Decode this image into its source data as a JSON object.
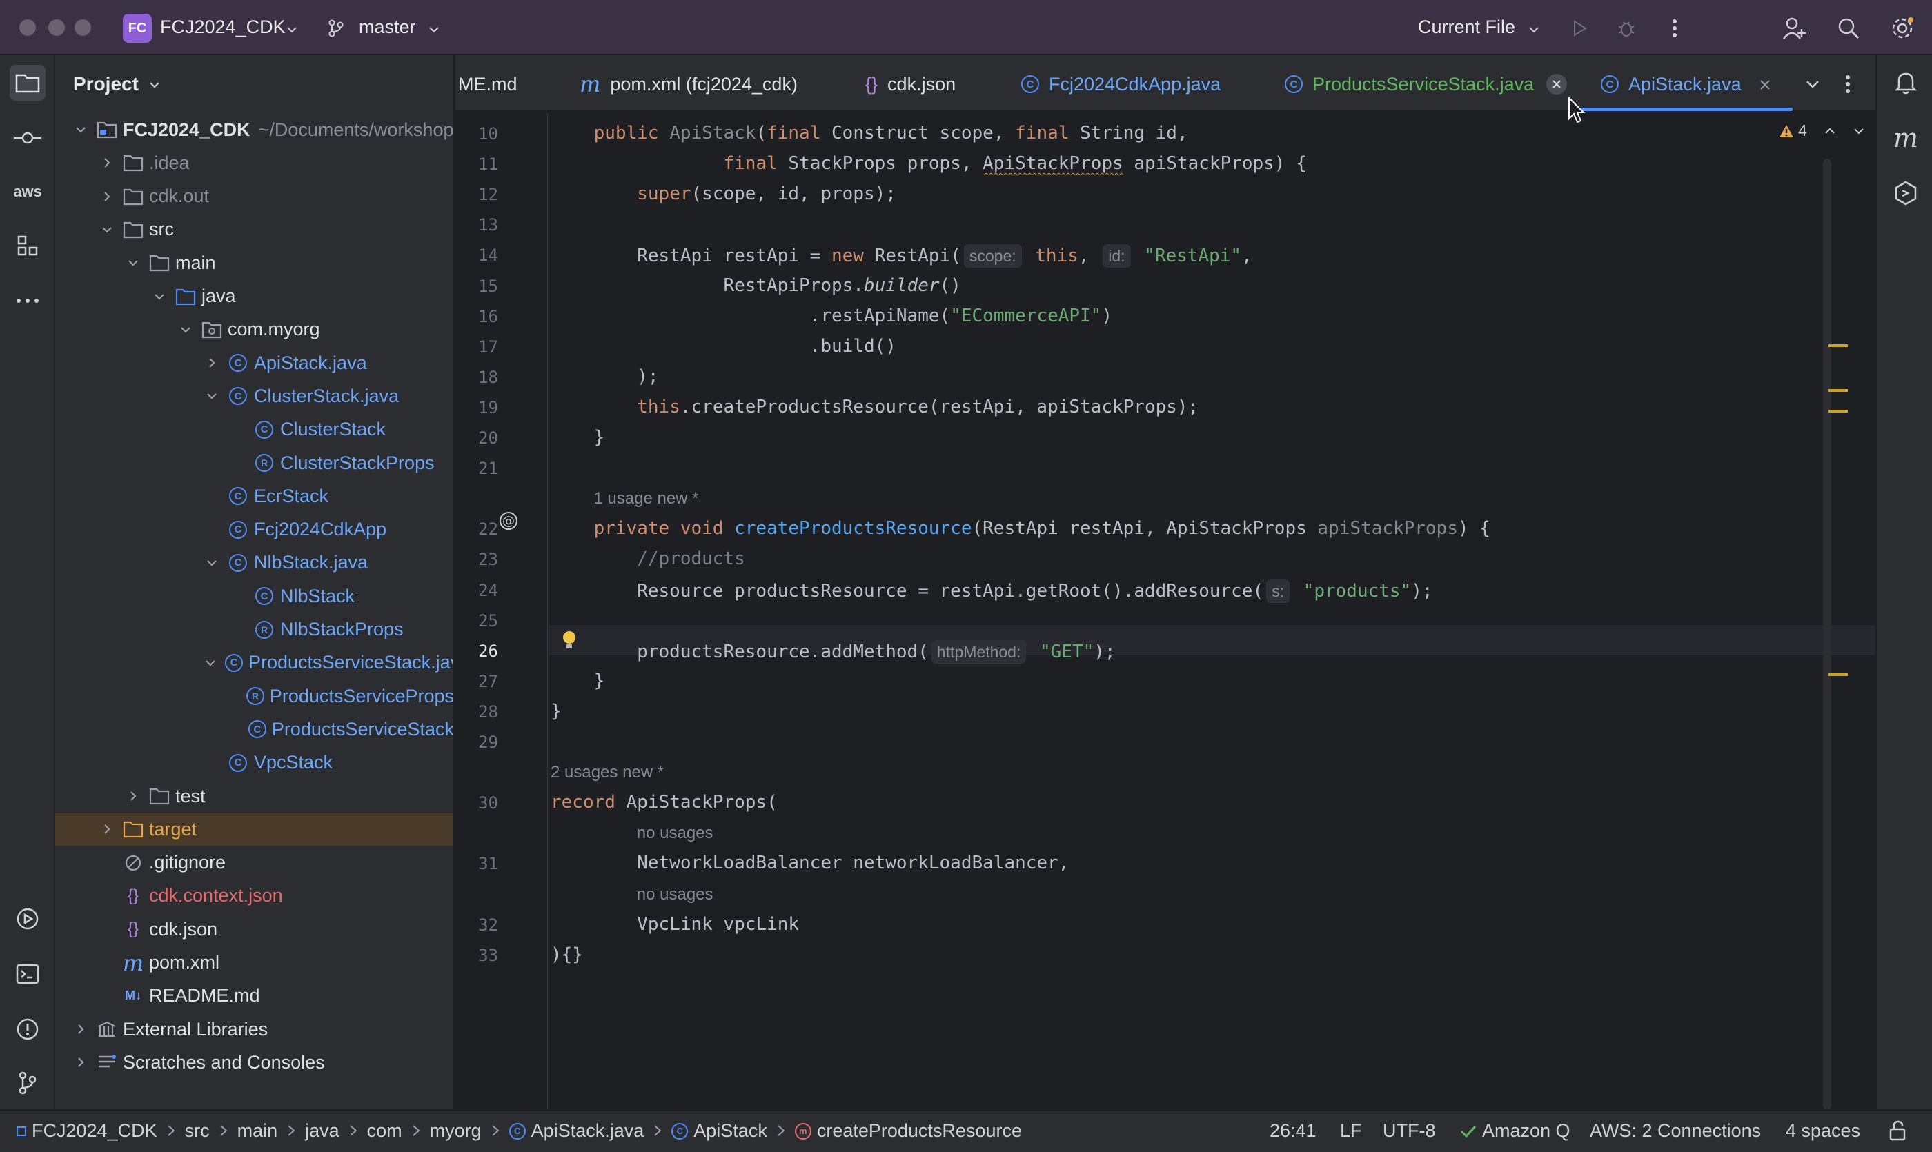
{
  "titlebar": {
    "project_badge": "FC",
    "project_name": "FCJ2024_CDK",
    "branch": "master",
    "run_config": "Current File"
  },
  "project_panel": {
    "title": "Project",
    "tree": [
      {
        "label": "FCJ2024_CDK",
        "extra": "~/Documents/workshop",
        "icon": "module-folder-icon",
        "expanded": true,
        "color": "white",
        "bold": true
      },
      {
        "label": ".idea",
        "icon": "folder-icon",
        "expanded": false,
        "color": "gray"
      },
      {
        "label": "cdk.out",
        "icon": "folder-icon",
        "expanded": false,
        "color": "gray"
      },
      {
        "label": "src",
        "icon": "folder-icon",
        "expanded": true,
        "color": "white"
      },
      {
        "label": "main",
        "icon": "folder-icon",
        "expanded": true,
        "color": "white"
      },
      {
        "label": "java",
        "icon": "source-folder-icon",
        "expanded": true,
        "color": "white"
      },
      {
        "label": "com.myorg",
        "icon": "package-icon",
        "expanded": true,
        "color": "white"
      },
      {
        "label": "ApiStack.java",
        "icon": "class-icon",
        "expanded": false,
        "color": "blue"
      },
      {
        "label": "ClusterStack.java",
        "icon": "class-icon",
        "expanded": true,
        "color": "blue"
      },
      {
        "label": "ClusterStack",
        "icon": "class-icon",
        "color": "blue"
      },
      {
        "label": "ClusterStackProps",
        "icon": "record-icon",
        "color": "blue"
      },
      {
        "label": "EcrStack",
        "icon": "class-icon",
        "color": "blue"
      },
      {
        "label": "Fcj2024CdkApp",
        "icon": "class-icon",
        "color": "blue"
      },
      {
        "label": "NlbStack.java",
        "icon": "class-icon",
        "expanded": true,
        "color": "blue"
      },
      {
        "label": "NlbStack",
        "icon": "class-icon",
        "color": "blue"
      },
      {
        "label": "NlbStackProps",
        "icon": "record-icon",
        "color": "blue"
      },
      {
        "label": "ProductsServiceStack.java",
        "icon": "class-icon",
        "expanded": true,
        "color": "blue"
      },
      {
        "label": "ProductsServiceProps",
        "icon": "record-icon",
        "color": "blue"
      },
      {
        "label": "ProductsServiceStack",
        "icon": "class-icon",
        "color": "blue"
      },
      {
        "label": "VpcStack",
        "icon": "class-icon",
        "color": "blue"
      },
      {
        "label": "test",
        "icon": "folder-icon",
        "expanded": false,
        "color": "white"
      },
      {
        "label": "target",
        "icon": "excluded-folder-icon",
        "expanded": false,
        "color": "orange",
        "selected": true
      },
      {
        "label": ".gitignore",
        "icon": "ignore-file-icon",
        "color": "white"
      },
      {
        "label": "cdk.context.json",
        "icon": "json-icon",
        "color": "red"
      },
      {
        "label": "cdk.json",
        "icon": "json-icon",
        "color": "white"
      },
      {
        "label": "pom.xml",
        "icon": "maven-icon",
        "color": "white"
      },
      {
        "label": "README.md",
        "icon": "markdown-icon",
        "color": "white"
      },
      {
        "label": "External Libraries",
        "icon": "library-icon",
        "expanded": false,
        "color": "white"
      },
      {
        "label": "Scratches and Consoles",
        "icon": "scratches-icon",
        "expanded": false,
        "color": "white"
      }
    ]
  },
  "tabs": [
    {
      "label": "ME.md",
      "icon": "markdown-icon",
      "color": "white"
    },
    {
      "label": "pom.xml (fcj2024_cdk)",
      "icon": "maven-icon",
      "color": "white"
    },
    {
      "label": "cdk.json",
      "icon": "json-icon",
      "color": "white"
    },
    {
      "label": "Fcj2024CdkApp.java",
      "icon": "class-icon",
      "color": "blue"
    },
    {
      "label": "ProductsServiceStack.java",
      "icon": "class-icon",
      "color": "green"
    },
    {
      "label": "ApiStack.java",
      "icon": "class-icon",
      "color": "blue",
      "active": true
    }
  ],
  "editor": {
    "warnings_count": "4",
    "current_line": 26,
    "lines": [
      {
        "n": "10",
        "html": "    <span class='kw'>public</span> <span class='param'>ApiStack</span>(<span class='kw'>final</span> Construct scope, <span class='kw'>final</span> String id,"
      },
      {
        "n": "11",
        "html": "                <span class='kw'>final</span> StackProps props, <span class='squig'>ApiStackProps</span> apiStackProps) {"
      },
      {
        "n": "12",
        "html": "        <span class='kw'>super</span>(scope, id, props);"
      },
      {
        "n": "13",
        "html": ""
      },
      {
        "n": "14",
        "html": "        RestApi restApi = <span class='kw'>new</span> RestApi(<span class='hint'>scope:</span> <span class='kw'>this</span>, <span class='hint'>id:</span> <span class='str'>\"RestApi\"</span>,"
      },
      {
        "n": "15",
        "html": "                RestApiProps.<i>builder</i>()"
      },
      {
        "n": "16",
        "html": "                        .restApiName(<span class='str'>\"ECommerceAPI\"</span>)"
      },
      {
        "n": "17",
        "html": "                        .build()"
      },
      {
        "n": "18",
        "html": "        );"
      },
      {
        "n": "19",
        "html": "        <span class='kw'>this</span>.createProductsResource(restApi, apiStackProps);"
      },
      {
        "n": "20",
        "html": "    }"
      },
      {
        "n": "21",
        "html": ""
      },
      {
        "lens": "1 usage   new *",
        "indent": 4
      },
      {
        "n": "22",
        "html": "    <span class='kw'>private void</span> <span class='fn'>createProductsResource</span>(RestApi restApi, ApiStackProps <span class='param'>apiStackProps</span>) {"
      },
      {
        "n": "23",
        "html": "        <span class='cm'>//products</span>"
      },
      {
        "n": "24",
        "html": "        Resource productsResource = restApi.getRoot().addResource(<span class='hint'>s:</span> <span class='str'>\"products\"</span>);"
      },
      {
        "n": "25",
        "html": ""
      },
      {
        "n": "26",
        "html": "        productsResource.addMethod(<span class='hint'>httpMethod:</span> <span class='str'>\"GET\"</span>);"
      },
      {
        "n": "27",
        "html": "    }"
      },
      {
        "n": "28",
        "html": "}"
      },
      {
        "n": "29",
        "html": ""
      },
      {
        "lens": "2 usages   new *",
        "indent": 0
      },
      {
        "n": "30",
        "html": "<span class='kw'>record</span> ApiStackProps("
      },
      {
        "lens": "no usages",
        "indent": 8
      },
      {
        "n": "31",
        "html": "        NetworkLoadBalancer networkLoadBalancer,"
      },
      {
        "lens": "no usages",
        "indent": 8
      },
      {
        "n": "32",
        "html": "        VpcLink vpcLink"
      },
      {
        "n": "33",
        "html": "){}"
      }
    ]
  },
  "statusbar": {
    "breadcrumbs": [
      "FCJ2024_CDK",
      "src",
      "main",
      "java",
      "com",
      "myorg",
      "ApiStack.java",
      "ApiStack",
      "createProductsResource"
    ],
    "position": "26:41",
    "line_sep": "LF",
    "encoding": "UTF-8",
    "amazon_q": "Amazon Q",
    "aws": "AWS: 2 Connections",
    "indent": "4 spaces"
  },
  "colors": {
    "accent": "#4f8cf6",
    "titlebar_bg": "#3b3144",
    "panel_bg": "#2b2d30",
    "editor_bg": "#1e1f22",
    "keyword": "#cf8e6d",
    "string": "#6aab73",
    "function": "#56a8f5"
  }
}
